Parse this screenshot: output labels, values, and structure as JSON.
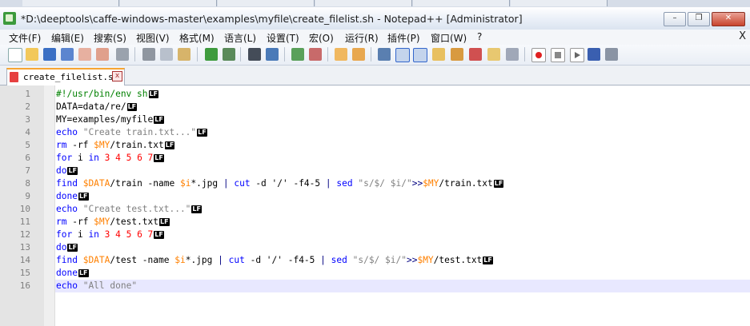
{
  "window": {
    "title": "*D:\\deeptools\\caffe-windows-master\\examples\\myfile\\create_filelist.sh - Notepad++ [Administrator]",
    "minimize_label": "–",
    "restore_label": "❐",
    "close_label": "✕"
  },
  "menu": {
    "items": [
      "文件(F)",
      "编辑(E)",
      "搜索(S)",
      "视图(V)",
      "格式(M)",
      "语言(L)",
      "设置(T)",
      "宏(O)",
      "运行(R)",
      "插件(P)",
      "窗口(W)",
      "?"
    ],
    "close_label": "X"
  },
  "toolbar": {
    "icons": [
      "new-file-icon",
      "open-file-icon",
      "save-icon",
      "save-all-icon",
      "close-icon",
      "close-all-icon",
      "print-icon",
      "cut-icon",
      "copy-icon",
      "paste-icon",
      "undo-icon",
      "redo-icon",
      "find-icon",
      "replace-icon",
      "zoom-in-icon",
      "zoom-out-icon",
      "sync-vertical-icon",
      "sync-horizontal-icon",
      "word-wrap-icon",
      "show-all-chars-icon",
      "indent-guide-icon",
      "document-map-icon",
      "function-list-icon",
      "udl-icon",
      "folder-workspace-icon",
      "monitoring-icon",
      "record-macro-icon",
      "stop-record-icon",
      "play-macro-icon",
      "run-macro-multiple-icon",
      "save-macro-icon"
    ]
  },
  "tab": {
    "label": "create_filelist.sh",
    "close_label": "x"
  },
  "editor": {
    "eol_marker": "LF",
    "lines": [
      {
        "n": "1",
        "tokens": [
          {
            "t": "#!/usr/bin/env sh",
            "c": "cm"
          }
        ]
      },
      {
        "n": "2",
        "tokens": [
          {
            "t": "DATA=data/re/",
            "c": ""
          }
        ]
      },
      {
        "n": "3",
        "tokens": [
          {
            "t": "MY=examples/myfile",
            "c": ""
          }
        ]
      },
      {
        "n": "4",
        "tokens": [
          {
            "t": "echo",
            "c": "kw"
          },
          {
            "t": " ",
            "c": ""
          },
          {
            "t": "\"Create train.txt...\"",
            "c": "str"
          }
        ]
      },
      {
        "n": "5",
        "tokens": [
          {
            "t": "rm",
            "c": "kw"
          },
          {
            "t": " -rf ",
            "c": ""
          },
          {
            "t": "$MY",
            "c": "var"
          },
          {
            "t": "/train.txt",
            "c": ""
          }
        ]
      },
      {
        "n": "6",
        "tokens": [
          {
            "t": "for",
            "c": "kw"
          },
          {
            "t": " i ",
            "c": ""
          },
          {
            "t": "in",
            "c": "kw"
          },
          {
            "t": " ",
            "c": ""
          },
          {
            "t": "3 4 5 6 7",
            "c": "num"
          }
        ]
      },
      {
        "n": "7",
        "tokens": [
          {
            "t": "do",
            "c": "kw"
          }
        ]
      },
      {
        "n": "8",
        "tokens": [
          {
            "t": "find",
            "c": "kw"
          },
          {
            "t": " ",
            "c": ""
          },
          {
            "t": "$DATA",
            "c": "var"
          },
          {
            "t": "/train -name ",
            "c": ""
          },
          {
            "t": "$i",
            "c": "var"
          },
          {
            "t": "*.jpg ",
            "c": ""
          },
          {
            "t": "|",
            "c": "op"
          },
          {
            "t": " ",
            "c": ""
          },
          {
            "t": "cut",
            "c": "kw"
          },
          {
            "t": " -d '/' -f4-5 ",
            "c": ""
          },
          {
            "t": "|",
            "c": "op"
          },
          {
            "t": " ",
            "c": ""
          },
          {
            "t": "sed",
            "c": "kw"
          },
          {
            "t": " ",
            "c": ""
          },
          {
            "t": "\"s/$/ $i/\"",
            "c": "str"
          },
          {
            "t": ">>",
            "c": "op"
          },
          {
            "t": "$MY",
            "c": "var"
          },
          {
            "t": "/train.txt",
            "c": ""
          }
        ]
      },
      {
        "n": "9",
        "tokens": [
          {
            "t": "done",
            "c": "kw"
          }
        ]
      },
      {
        "n": "10",
        "tokens": [
          {
            "t": "echo",
            "c": "kw"
          },
          {
            "t": " ",
            "c": ""
          },
          {
            "t": "\"Create test.txt...\"",
            "c": "str"
          }
        ]
      },
      {
        "n": "11",
        "tokens": [
          {
            "t": "rm",
            "c": "kw"
          },
          {
            "t": " -rf ",
            "c": ""
          },
          {
            "t": "$MY",
            "c": "var"
          },
          {
            "t": "/test.txt",
            "c": ""
          }
        ]
      },
      {
        "n": "12",
        "tokens": [
          {
            "t": "for",
            "c": "kw"
          },
          {
            "t": " i ",
            "c": ""
          },
          {
            "t": "in",
            "c": "kw"
          },
          {
            "t": " ",
            "c": ""
          },
          {
            "t": "3 4 5 6 7",
            "c": "num"
          }
        ]
      },
      {
        "n": "13",
        "tokens": [
          {
            "t": "do",
            "c": "kw"
          }
        ]
      },
      {
        "n": "14",
        "tokens": [
          {
            "t": "find",
            "c": "kw"
          },
          {
            "t": " ",
            "c": ""
          },
          {
            "t": "$DATA",
            "c": "var"
          },
          {
            "t": "/test -name ",
            "c": ""
          },
          {
            "t": "$i",
            "c": "var"
          },
          {
            "t": "*.jpg ",
            "c": ""
          },
          {
            "t": "|",
            "c": "op"
          },
          {
            "t": " ",
            "c": ""
          },
          {
            "t": "cut",
            "c": "kw"
          },
          {
            "t": " -d '/' -f4-5 ",
            "c": ""
          },
          {
            "t": "|",
            "c": "op"
          },
          {
            "t": " ",
            "c": ""
          },
          {
            "t": "sed",
            "c": "kw"
          },
          {
            "t": " ",
            "c": ""
          },
          {
            "t": "\"s/$/ $i/\"",
            "c": "str"
          },
          {
            "t": ">>",
            "c": "op"
          },
          {
            "t": "$MY",
            "c": "var"
          },
          {
            "t": "/test.txt",
            "c": ""
          }
        ]
      },
      {
        "n": "15",
        "tokens": [
          {
            "t": "done",
            "c": "kw"
          }
        ]
      },
      {
        "n": "16",
        "tokens": [
          {
            "t": "echo",
            "c": "kw"
          },
          {
            "t": " ",
            "c": ""
          },
          {
            "t": "\"All done\"",
            "c": "str"
          }
        ],
        "eol": false,
        "current": true
      }
    ]
  },
  "colors": {
    "comment": "#008000",
    "keyword": "#0000ff",
    "variable": "#ff8000",
    "number": "#ff0000",
    "string": "#808080",
    "current_line": "#e8e8ff",
    "tab_accent": "#f7a531"
  }
}
